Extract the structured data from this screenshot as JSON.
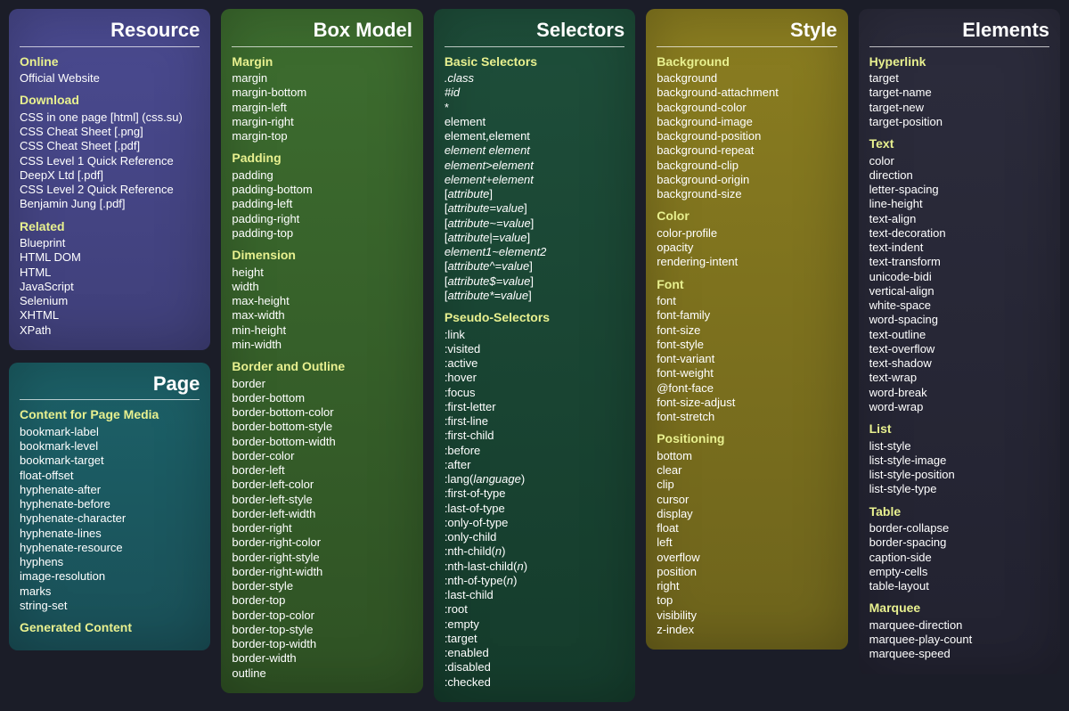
{
  "panels": [
    {
      "id": "resource",
      "title": "Resource",
      "color": "p-purple",
      "sections": [
        {
          "heading": "Online",
          "items": [
            "Official Website"
          ]
        },
        {
          "heading": "Download",
          "items": [
            "CSS in one page [html] (css.su)",
            "CSS Cheat Sheet [.png]",
            "CSS Cheat Sheet [.pdf]",
            "CSS Level 1 Quick Reference DeepX Ltd [.pdf]",
            "CSS Level 2 Quick Reference Benjamin Jung [.pdf]"
          ]
        },
        {
          "heading": "Related",
          "items": [
            "Blueprint",
            "HTML DOM",
            "HTML",
            "JavaScript",
            "Selenium",
            "XHTML",
            "XPath"
          ]
        }
      ]
    },
    {
      "id": "page",
      "title": "Page",
      "color": "p-teal",
      "sections": [
        {
          "heading": "Content for Page Media",
          "items": [
            "bookmark-label",
            "bookmark-level",
            "bookmark-target",
            "float-offset",
            "hyphenate-after",
            "hyphenate-before",
            "hyphenate-character",
            "hyphenate-lines",
            "hyphenate-resource",
            "hyphens",
            "image-resolution",
            "marks",
            "string-set"
          ]
        },
        {
          "heading": "Generated Content",
          "items": []
        }
      ]
    },
    {
      "id": "boxmodel",
      "title": "Box Model",
      "color": "p-forest",
      "sections": [
        {
          "heading": "Margin",
          "items": [
            "margin",
            "margin-bottom",
            "margin-left",
            "margin-right",
            "margin-top"
          ]
        },
        {
          "heading": "Padding",
          "items": [
            "padding",
            "padding-bottom",
            "padding-left",
            "padding-right",
            "padding-top"
          ]
        },
        {
          "heading": "Dimension",
          "items": [
            "height",
            "width",
            "max-height",
            "max-width",
            "min-height",
            "min-width"
          ]
        },
        {
          "heading": "Border and Outline",
          "items": [
            "border",
            "border-bottom",
            "border-bottom-color",
            "border-bottom-style",
            "border-bottom-width",
            "border-color",
            "border-left",
            "border-left-color",
            "border-left-style",
            "border-left-width",
            "border-right",
            "border-right-color",
            "border-right-style",
            "border-right-width",
            "border-style",
            "border-top",
            "border-top-color",
            "border-top-style",
            "border-top-width",
            "border-width",
            "outline"
          ]
        }
      ]
    },
    {
      "id": "selectors",
      "title": "Selectors",
      "color": "p-darkgrn",
      "sections": [
        {
          "heading": "Basic Selectors",
          "items": [
            "<em>.class</em>",
            "<em>#id</em>",
            "*",
            "element",
            "element,element",
            "<em>element element</em>",
            "<em>element>element</em>",
            "<em>element+element</em>",
            "[<em>attribute</em>]",
            "[<em>attribute=value</em>]",
            "[<em>attribute~=value</em>]",
            "[<em>attribute</em>|=<em>value</em>]",
            "<em>element1~element2</em>",
            "[<em>attribute^=value</em>]",
            "[<em>attribute$=value</em>]",
            "[<em>attribute*=value</em>]"
          ]
        },
        {
          "heading": "Pseudo-Selectors",
          "items": [
            ":link",
            ":visited",
            ":active",
            ":hover",
            ":focus",
            ":first-letter",
            ":first-line",
            ":first-child",
            ":before",
            ":after",
            ":lang(<em>language</em>)",
            ":first-of-type",
            ":last-of-type",
            ":only-of-type",
            ":only-child",
            ":nth-child(<em>n</em>)",
            ":nth-last-child(<em>n</em>)",
            ":nth-of-type(<em>n</em>)",
            ":last-child",
            ":root",
            ":empty",
            ":target",
            ":enabled",
            ":disabled",
            ":checked"
          ]
        }
      ]
    },
    {
      "id": "style",
      "title": "Style",
      "color": "p-olive",
      "sections": [
        {
          "heading": "Background",
          "items": [
            "background",
            "background-attachment",
            "background-color",
            "background-image",
            "background-position",
            "background-repeat",
            "background-clip",
            "background-origin",
            "background-size"
          ]
        },
        {
          "heading": "Color",
          "items": [
            "color-profile",
            "opacity",
            "rendering-intent"
          ]
        },
        {
          "heading": "Font",
          "items": [
            "font",
            "font-family",
            "font-size",
            "font-style",
            "font-variant",
            "font-weight",
            "@font-face",
            "font-size-adjust",
            "font-stretch"
          ]
        },
        {
          "heading": "Positioning",
          "items": [
            "bottom",
            "clear",
            "clip",
            "cursor",
            "display",
            "float",
            "left",
            "overflow",
            "position",
            "right",
            "top",
            "visibility",
            "z-index"
          ]
        }
      ]
    },
    {
      "id": "elements",
      "title": "Elements",
      "color": "p-dark",
      "sections": [
        {
          "heading": "Hyperlink",
          "items": [
            "target",
            "target-name",
            "target-new",
            "target-position"
          ]
        },
        {
          "heading": "Text",
          "items": [
            "color",
            "direction",
            "letter-spacing",
            "line-height",
            "text-align",
            "text-decoration",
            "text-indent",
            "text-transform",
            "unicode-bidi",
            "vertical-align",
            "white-space",
            "word-spacing",
            "text-outline",
            "text-overflow",
            "text-shadow",
            "text-wrap",
            "word-break",
            "word-wrap"
          ]
        },
        {
          "heading": "List",
          "items": [
            "list-style",
            "list-style-image",
            "list-style-position",
            "list-style-type"
          ]
        },
        {
          "heading": "Table",
          "items": [
            "border-collapse",
            "border-spacing",
            "caption-side",
            "empty-cells",
            "table-layout"
          ]
        },
        {
          "heading": "Marquee",
          "items": [
            "marquee-direction",
            "marquee-play-count",
            "marquee-speed"
          ]
        }
      ]
    }
  ],
  "layout": {
    "columns": [
      [
        "resource",
        "page"
      ],
      [
        "boxmodel"
      ],
      [
        "selectors"
      ],
      [
        "style"
      ],
      [
        "elements"
      ]
    ]
  }
}
